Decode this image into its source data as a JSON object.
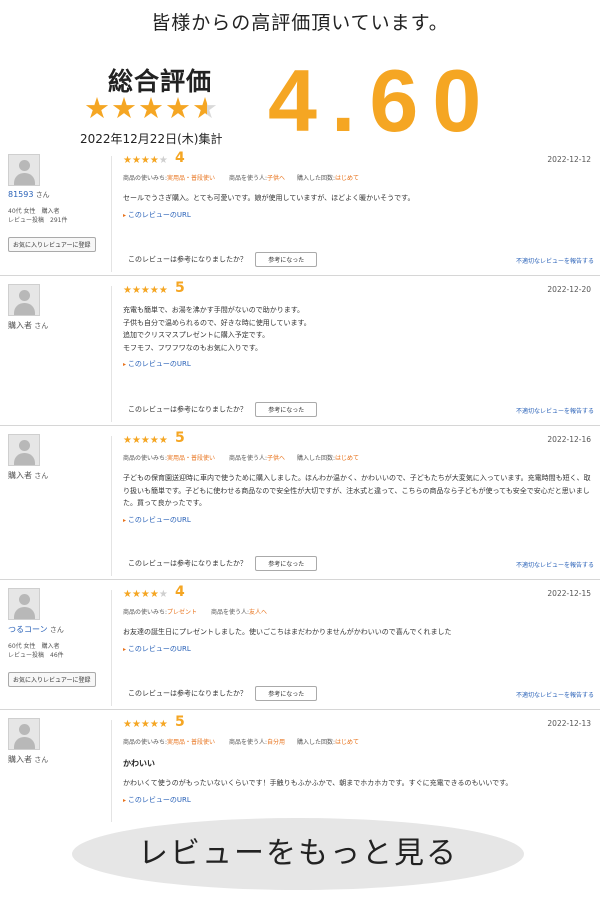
{
  "headline": "皆様からの高評価頂いています。",
  "summary": {
    "label": "総合評価",
    "stars": "★★★★",
    "half_star": "★",
    "date": "2022年12月22日(木)集計",
    "score": "4.60"
  },
  "reviews": [
    {
      "avatar_icon": "user-avatar-icon",
      "name": "81593",
      "san": "さん",
      "name_is_link": true,
      "meta1": "40代 女性　購入者",
      "meta2": "レビュー投稿　291件",
      "fav_button": "お気に入りレビュアーに登録",
      "stars_on": "★★★★",
      "stars_off": "★",
      "score": "4",
      "date": "2022-12-12",
      "tag1_label": "商品の使いみち:",
      "tag1_value": "実用品・普段使い",
      "tag2_label": "商品を使う人:",
      "tag2_value": "子供へ",
      "tag3_label": "購入した回数:",
      "tag3_value": "はじめて",
      "title": "",
      "body": "セールでうさぎ購入。とても可愛いです。娘が使用していますが、ほどよく暖かいそうです。",
      "link": "このレビューのURL",
      "helpful_q": "このレビューは参考になりましたか？",
      "helpful_btn": "参考になった",
      "report": "不適切なレビューを報告する"
    },
    {
      "avatar_icon": "user-avatar-icon",
      "name": "購入者",
      "san": "さん",
      "name_is_link": false,
      "meta1": "",
      "meta2": "",
      "fav_button": "",
      "stars_on": "★★★★★",
      "stars_off": "",
      "score": "5",
      "date": "2022-12-20",
      "tag1_label": "",
      "tag1_value": "",
      "tag2_label": "",
      "tag2_value": "",
      "tag3_label": "",
      "tag3_value": "",
      "title": "",
      "body": "充電も簡単で、お湯を沸かす手間がないので助かります。\n子供も自分で温められるので、好きな時に使用しています。\n追加でクリスマスプレゼントに購入予定です。\nモフモフ、フワフワなのもお気に入りです。",
      "link": "このレビューのURL",
      "helpful_q": "このレビューは参考になりましたか？",
      "helpful_btn": "参考になった",
      "report": "不適切なレビューを報告する"
    },
    {
      "avatar_icon": "user-avatar-icon",
      "name": "購入者",
      "san": "さん",
      "name_is_link": false,
      "meta1": "",
      "meta2": "",
      "fav_button": "",
      "stars_on": "★★★★★",
      "stars_off": "",
      "score": "5",
      "date": "2022-12-16",
      "tag1_label": "商品の使いみち:",
      "tag1_value": "実用品・普段使い",
      "tag2_label": "商品を使う人:",
      "tag2_value": "子供へ",
      "tag3_label": "購入した回数:",
      "tag3_value": "はじめて",
      "title": "",
      "body": "子どもの保育園送迎時に車内で使うために購入しました。ほんわか温かく、かわいいので、子どもたちが大変気に入っています。充電時間も短く、取り扱いも簡単です。子どもに使わせる商品なので安全性が大切ですが、注水式と違って、こちらの商品なら子どもが使っても安全で安心だと思いました。買って良かったです。",
      "link": "このレビューのURL",
      "helpful_q": "このレビューは参考になりましたか？",
      "helpful_btn": "参考になった",
      "report": "不適切なレビューを報告する"
    },
    {
      "avatar_icon": "user-avatar-icon",
      "name": "つるコーン",
      "san": "さん",
      "name_is_link": true,
      "meta1": "60代 女性　購入者",
      "meta2": "レビュー投稿　46件",
      "fav_button": "お気に入りレビュアーに登録",
      "stars_on": "★★★★",
      "stars_off": "★",
      "score": "4",
      "date": "2022-12-15",
      "tag1_label": "商品の使いみち:",
      "tag1_value": "プレゼント",
      "tag2_label": "商品を使う人:",
      "tag2_value": "友人へ",
      "tag3_label": "",
      "tag3_value": "",
      "title": "",
      "body": "お友達の誕生日にプレゼントしました。使いごこちはまだわかりませんがかわいいので喜んでくれました",
      "link": "このレビューのURL",
      "helpful_q": "このレビューは参考になりましたか？",
      "helpful_btn": "参考になった",
      "report": "不適切なレビューを報告する"
    },
    {
      "avatar_icon": "user-avatar-icon",
      "name": "購入者",
      "san": "さん",
      "name_is_link": false,
      "meta1": "",
      "meta2": "",
      "fav_button": "",
      "stars_on": "★★★★★",
      "stars_off": "",
      "score": "5",
      "date": "2022-12-13",
      "tag1_label": "商品の使いみち:",
      "tag1_value": "実用品・普段使い",
      "tag2_label": "商品を使う人:",
      "tag2_value": "自分用",
      "tag3_label": "購入した回数:",
      "tag3_value": "はじめて",
      "title": "かわいい",
      "body": "かわいくて使うのがもったいないくらいです！手触りもふかふかで、朝までホカホカです。すぐに充電できるのもいいです。",
      "link": "このレビューのURL",
      "helpful_q": "",
      "helpful_btn": "",
      "report": ""
    }
  ],
  "more_button": "レビューをもっと見る",
  "colors": {
    "accent": "#f5a623",
    "link": "#2a62b8",
    "tag": "#e8731c"
  }
}
